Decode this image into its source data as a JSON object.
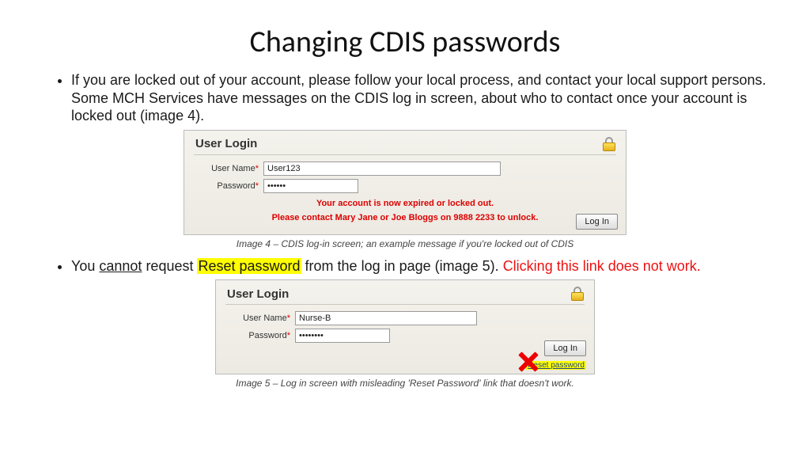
{
  "title": "Changing CDIS passwords",
  "bullet1": "If you are locked out of your account, please follow your local process, and contact your local support persons. Some MCH Services have messages on the CDIS log in screen, about who to contact once your account is locked out (image 4).",
  "panel1": {
    "heading": "User Login",
    "username_label": "User Name",
    "username_value": "User123",
    "password_label": "Password",
    "password_value": "••••••",
    "err1": "Your account is now expired or locked out.",
    "err2": "Please contact Mary Jane or Joe Bloggs on 9888 2233 to unlock.",
    "login_btn": "Log In"
  },
  "caption1": "Image 4 – CDIS log-in screen; an example message if you're locked out of CDIS",
  "bullet2": {
    "a": "You ",
    "cannot": "cannot",
    "b": " request ",
    "reset": "Reset password",
    "c": " from the log in page (image 5). ",
    "red": "Clicking this link does not work",
    "d": "."
  },
  "panel2": {
    "heading": "User Login",
    "username_label": "User Name",
    "username_value": "Nurse-B",
    "password_label": "Password",
    "password_value": "••••••••",
    "login_btn": "Log In",
    "reset_link": "Reset password"
  },
  "caption2": "Image 5 – Log in screen with misleading 'Reset Password' link that doesn't work."
}
